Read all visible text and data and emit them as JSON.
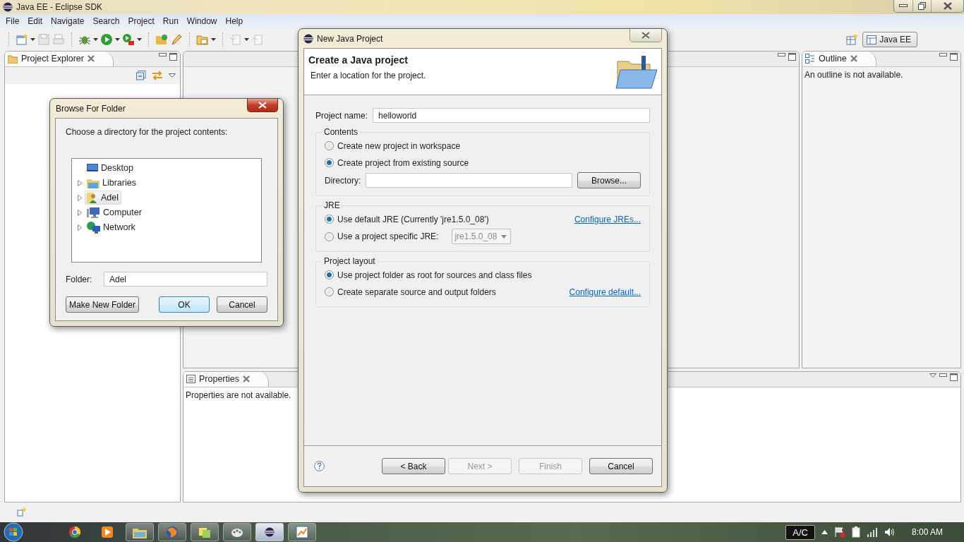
{
  "window": {
    "title": "Java EE - Eclipse SDK"
  },
  "menu": [
    "File",
    "Edit",
    "Navigate",
    "Search",
    "Project",
    "Run",
    "Window",
    "Help"
  ],
  "perspective": {
    "label": "Java EE",
    "selected": true
  },
  "project_explorer": {
    "title": "Project Explorer"
  },
  "outline": {
    "title": "Outline",
    "message": "An outline is not available."
  },
  "properties": {
    "title": "Properties",
    "message": "Properties are not available."
  },
  "new_project_dialog": {
    "title": "New Java Project",
    "heading": "Create a Java project",
    "subheading": "Enter a location for the project.",
    "project_name": {
      "label": "Project name:",
      "value": "helloworld"
    },
    "contents": {
      "legend": "Contents",
      "options": [
        {
          "label": "Create new project in workspace",
          "selected": false
        },
        {
          "label": "Create project from existing source",
          "selected": true
        }
      ],
      "directory_label": "Directory:",
      "browse_button": "Browse..."
    },
    "jre": {
      "legend": "JRE",
      "options": [
        {
          "label": "Use default JRE (Currently 'jre1.5.0_08')",
          "selected": true
        },
        {
          "label": "Use a project specific JRE:",
          "selected": false,
          "dropdown": {
            "value": "jre1.5.0_08",
            "disabled": true
          }
        }
      ],
      "link": "Configure JREs..."
    },
    "layout": {
      "legend": "Project layout",
      "options": [
        {
          "label": "Use project folder as root for sources and class files",
          "selected": true
        },
        {
          "label": "Create separate source and output folders",
          "selected": false
        }
      ],
      "link": "Configure default..."
    },
    "buttons": [
      {
        "label": "< Back",
        "disabled": false
      },
      {
        "label": "Next >",
        "disabled": true
      },
      {
        "label": "Finish",
        "disabled": true
      },
      {
        "label": "Cancel",
        "disabled": false
      }
    ]
  },
  "browse_dialog": {
    "title": "Browse For Folder",
    "prompt": "Choose a directory for the project contents:",
    "tree": [
      {
        "label": "Desktop",
        "kind": "desktop",
        "expandable": false,
        "selected": false
      },
      {
        "label": "Libraries",
        "kind": "library",
        "expandable": true,
        "selected": false
      },
      {
        "label": "Adel",
        "kind": "user",
        "expandable": true,
        "selected": true
      },
      {
        "label": "Computer",
        "kind": "computer",
        "expandable": true,
        "selected": false
      },
      {
        "label": "Network",
        "kind": "network",
        "expandable": true,
        "selected": false
      }
    ],
    "folder": {
      "label": "Folder:",
      "value": "Adel"
    },
    "buttons": [
      {
        "label": "Make New Folder",
        "default": false
      },
      {
        "label": "OK",
        "default": true
      },
      {
        "label": "Cancel",
        "default": false
      }
    ]
  },
  "taskbar": {
    "power_label": "A/C",
    "time": "8:00 AM"
  }
}
